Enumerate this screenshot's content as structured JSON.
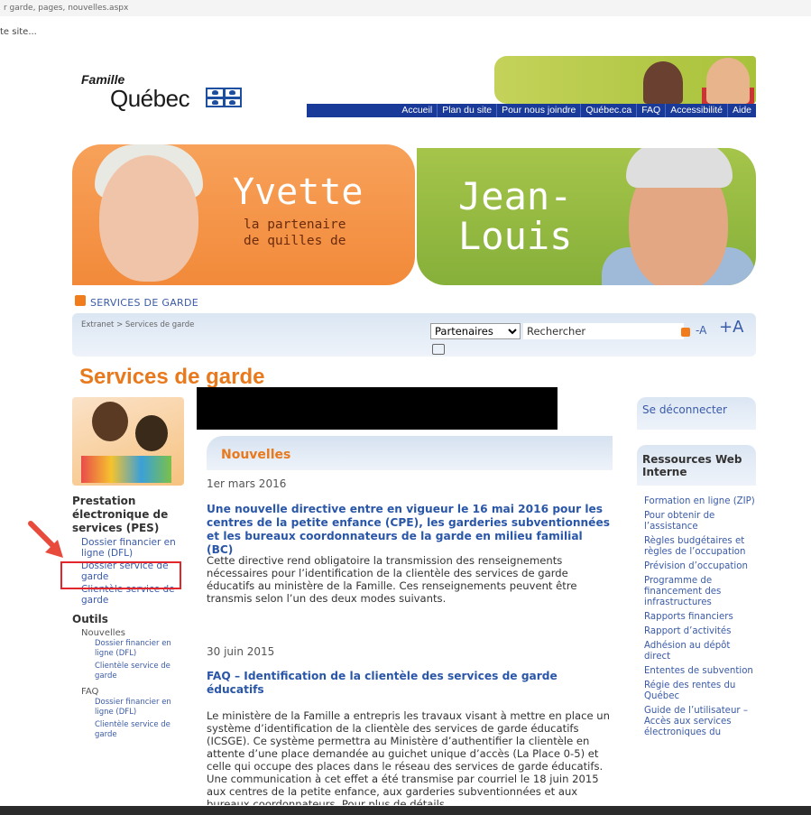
{
  "browser": {
    "url_fragment": "r garde, pages, nouvelles.aspx",
    "site_text": "te site..."
  },
  "header": {
    "logo_famille": "Famille",
    "logo_quebec": "Québec",
    "nav": [
      "Accueil",
      "Plan du site",
      "Pour nous joindre",
      "Québec.ca",
      "FAQ",
      "Accessibilité",
      "Aide"
    ]
  },
  "hero": {
    "left_name": "Yvette",
    "left_sub_1": "la partenaire",
    "left_sub_2": "de quilles de",
    "right_name_1": "Jean-",
    "right_name_2": "Louis"
  },
  "section_label": "SERVICES DE GARDE",
  "breadcrumb": "Extranet > Services de garde",
  "search": {
    "selected": "Partenaires",
    "options": [
      "Partenaires"
    ],
    "value": "Rechercher"
  },
  "font_sizes": {
    "small": "-A",
    "large": "+A"
  },
  "page_title": "Services de garde",
  "left_nav": {
    "pes_heading": "Prestation électronique de services (PES)",
    "pes_links": [
      "Dossier financier en ligne (DFL)",
      "Dossier service de garde",
      "Clientèle service de garde"
    ],
    "tools_heading": "Outils",
    "nouvelles": "Nouvelles",
    "nouvelles_links": [
      "Dossier financier en ligne (DFL)",
      "Clientèle service de garde"
    ],
    "faq": "FAQ",
    "faq_links": [
      "Dossier financier en ligne (DFL)",
      "Clientèle service de garde"
    ]
  },
  "news": {
    "heading": "Nouvelles",
    "items": [
      {
        "date": "1er mars 2016",
        "title": "Une nouvelle directive entre en vigueur le 16 mai 2016 pour les centres de la petite enfance (CPE), les garderies subventionnées et les bureaux coordonnateurs de la garde en milieu familial (BC)",
        "body": "Cette directive rend obligatoire la transmission des renseignements nécessaires pour l’identification de la clientèle des services de garde éducatifs au ministère de la Famille. Ces renseignements peuvent être transmis selon l’un des deux modes suivants."
      },
      {
        "date": "30 juin 2015",
        "title": "FAQ – Identification de la clientèle des services de garde éducatifs",
        "body": "Le ministère de la Famille a entrepris les travaux visant à mettre en place un système d’identification de la clientèle des services de garde éducatifs (ICSGE). Ce système permettra au Ministère d’authentifier la clientèle en attente d’une place demandée au guichet unique d’accès (La Place 0-5) et celle qui occupe des places dans le réseau des services de garde éducatifs. Une communication à cet effet a été transmise par courriel le 18 juin 2015 aux centres de la petite enfance, aux garderies subventionnées et aux bureaux coordonnateurs. Pour plus de détails,"
      }
    ]
  },
  "right_sidebar": {
    "logout": "Se déconnecter",
    "resources_title": "Ressources Web Interne",
    "links": [
      "Formation en ligne (ZIP)",
      "Pour obtenir de l’assistance",
      "Règles budgétaires et règles de l’occupation",
      "Prévision d’occupation",
      "Programme de financement des infrastructures",
      "Rapports financiers",
      "Rapport d’activités",
      "Adhésion au dépôt direct",
      "Ententes de subvention",
      "Régie des rentes du Québec",
      "Guide de l’utilisateur – Accès aux services électroniques du"
    ]
  },
  "colors": {
    "accent_orange": "#e8791c",
    "nav_blue": "#1a3a9a",
    "link_blue": "#2a56a8",
    "highlight_red": "#e3262c"
  }
}
